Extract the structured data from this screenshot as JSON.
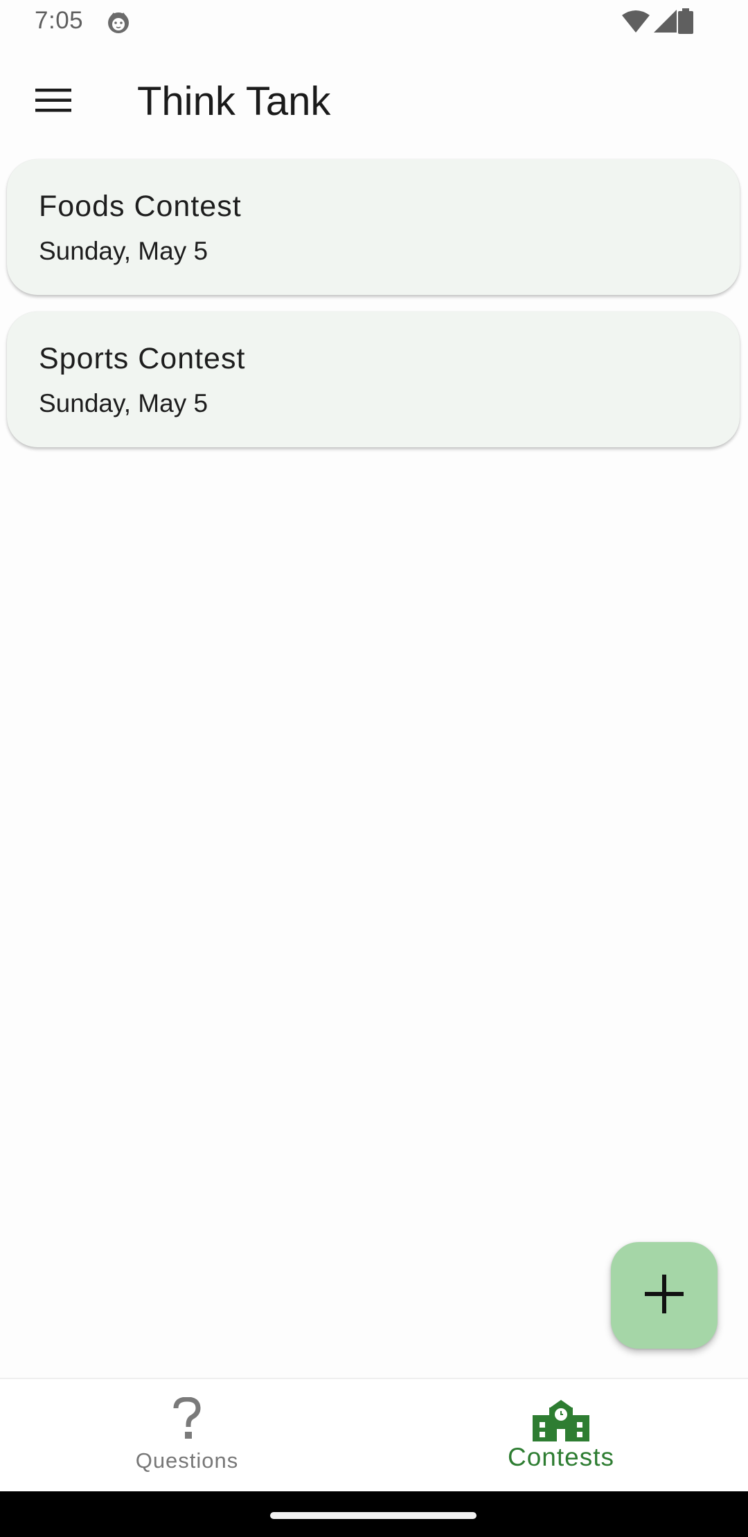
{
  "status_bar": {
    "time": "7:05",
    "icons": [
      "notification-cat-icon",
      "wifi-icon",
      "signal-icon",
      "battery-icon"
    ]
  },
  "app_bar": {
    "title": "Think Tank",
    "menu_icon": "hamburger-menu-icon"
  },
  "contests": [
    {
      "title": "Foods Contest",
      "date": "Sunday, May 5"
    },
    {
      "title": "Sports Contest",
      "date": "Sunday, May 5"
    }
  ],
  "fab": {
    "icon": "plus-icon",
    "color": "#a5d6a7"
  },
  "bottom_nav": {
    "items": [
      {
        "label": "Questions",
        "icon": "question-mark-icon",
        "active": false
      },
      {
        "label": "Contests",
        "icon": "school-building-icon",
        "active": true
      }
    ],
    "active_color": "#2e7d32",
    "inactive_color": "#777777"
  },
  "colors": {
    "card_background": "#f1f5f1",
    "accent": "#2e7d32"
  }
}
